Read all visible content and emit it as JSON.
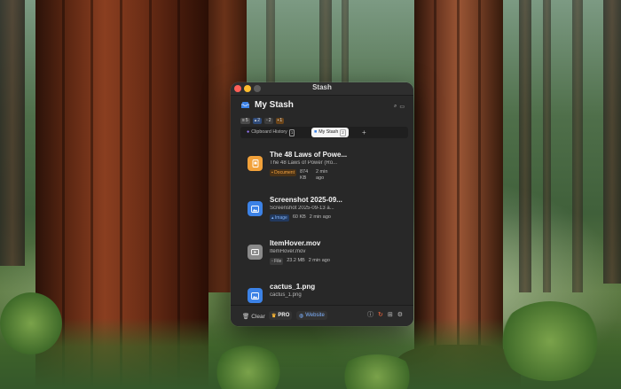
{
  "window": {
    "title": "Stash"
  },
  "header": {
    "title": "My Stash",
    "search_icon": "search-icon",
    "window_icon": "window-icon"
  },
  "counts": {
    "all": "5",
    "images": "2",
    "files": "2",
    "documents": "1"
  },
  "tabs": [
    {
      "label": "Clipboard History",
      "shortcut": "1"
    },
    {
      "label": "My Stash",
      "shortcut": "2"
    }
  ],
  "items": [
    {
      "title": "The 48 Laws of Powe...",
      "subtitle": "The 48 Laws of Power (Ro...",
      "type": "Document",
      "size": "874 KB",
      "time": "2 min ago"
    },
    {
      "title": "Screenshot 2025-09...",
      "subtitle": "Screenshot 2025-09-13 a...",
      "type": "Image",
      "size": "60 KB",
      "time": "2 min ago"
    },
    {
      "title": "ItemHover.mov",
      "subtitle": "ItemHover.mov",
      "type": "File",
      "size": "23.2 MB",
      "time": "2 min ago"
    },
    {
      "title": "cactus_1.png",
      "subtitle": "cactus_1.png"
    }
  ],
  "footer": {
    "clear_label": "Clear",
    "pro_label": "PRO",
    "website_label": "Website"
  },
  "colors": {
    "window_bg": "#282828",
    "document_accent": "#f1a13a",
    "image_accent": "#3c82e6",
    "file_accent": "#8a8a8a"
  }
}
